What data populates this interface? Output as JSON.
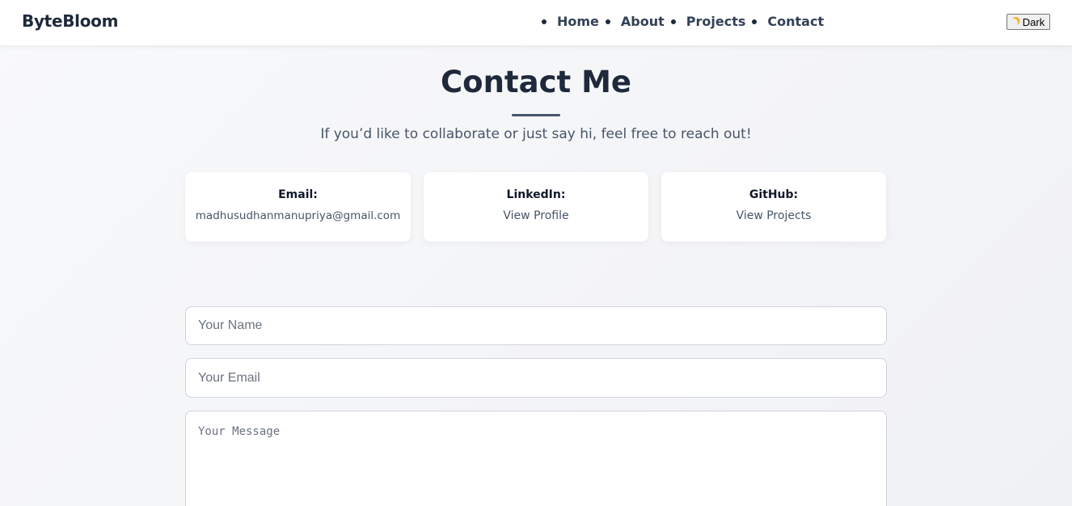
{
  "nav": {
    "brand": "ByteBloom",
    "items": [
      {
        "label": "Home"
      },
      {
        "label": "About"
      },
      {
        "label": "Projects"
      },
      {
        "label": "Contact"
      }
    ],
    "theme_toggle": {
      "label": "Dark",
      "icon": "moon-icon"
    }
  },
  "contact": {
    "title": "Contact Me",
    "subtitle": "If you’d like to collaborate or just say hi, feel free to reach out!",
    "cards": [
      {
        "label": "Email:",
        "value": "madhusudhanmanupriya@gmail.com"
      },
      {
        "label": "LinkedIn:",
        "value": "View Profile"
      },
      {
        "label": "GitHub:",
        "value": "View Projects"
      }
    ]
  },
  "form": {
    "name_placeholder": "Your Name",
    "email_placeholder": "Your Email",
    "message_placeholder": "Your Message"
  },
  "colors": {
    "text_dark": "#1e293b",
    "text_muted": "#475569",
    "accent_underline": "#475569",
    "background": "#f4f5f7"
  }
}
